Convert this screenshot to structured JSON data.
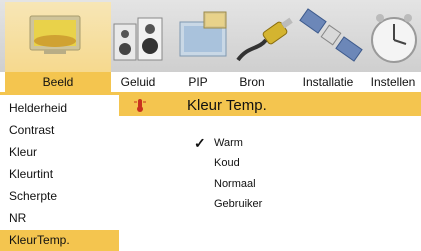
{
  "tabs": [
    {
      "label": "Beeld",
      "active": true
    },
    {
      "label": "Geluid",
      "active": false
    },
    {
      "label": "PIP",
      "active": false
    },
    {
      "label": "Bron",
      "active": false
    },
    {
      "label": "Installatie",
      "active": false
    },
    {
      "label": "Instellen",
      "active": false
    }
  ],
  "icons": [
    "tv-picture-icon",
    "speakers-icon",
    "pip-icon",
    "cable-connector-icon",
    "satellite-icon",
    "clock-icon"
  ],
  "menu": {
    "items": [
      "Helderheid",
      "Contrast",
      "Kleur",
      "Kleurtint",
      "Scherpte",
      "NR",
      "KleurTemp."
    ],
    "selected": "KleurTemp."
  },
  "panel": {
    "title": "Kleur Temp.",
    "options": [
      "Warm",
      "Koud",
      "Normaal",
      "Gebruiker"
    ],
    "checked": "Warm",
    "check_glyph": "✓"
  },
  "colors": {
    "accent": "#f4c54f",
    "active_tab_icon_bg": "#f6d98e"
  }
}
